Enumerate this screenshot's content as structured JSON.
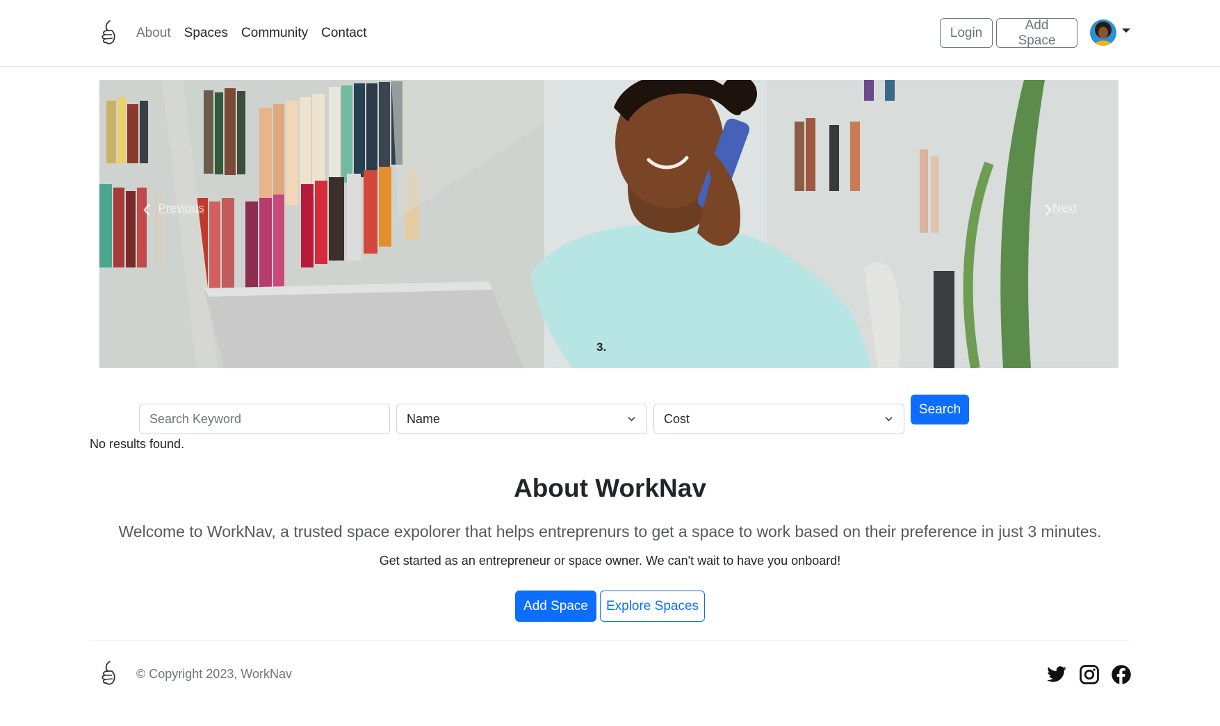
{
  "nav": {
    "links": [
      "About",
      "Spaces",
      "Community",
      "Contact"
    ],
    "login": "Login",
    "add_space": "Add Space"
  },
  "carousel": {
    "prev_label": "Previous",
    "next_label": "Next",
    "indicator": "3."
  },
  "search": {
    "keyword_placeholder": "Search Keyword",
    "name_select": "Name",
    "cost_select": "Cost",
    "button": "Search",
    "no_results": "No results found."
  },
  "about": {
    "title": "About WorkNav",
    "lead": "Welcome to WorkNav, a trusted space expolorer that helps entreprenurs to get a space to work based on their preference in just 3 minutes.",
    "sub": "Get started as an entrepreneur or space owner. We can't wait to have you onboard!",
    "add_space": "Add Space",
    "explore": "Explore Spaces"
  },
  "footer": {
    "copyright": "© Copyright 2023, WorkNav"
  },
  "colors": {
    "primary": "#0d6efd",
    "secondary": "#6c757d"
  },
  "icons": [
    "hand-logo-icon",
    "chevron-down-icon",
    "twitter-icon",
    "instagram-icon",
    "facebook-icon"
  ]
}
